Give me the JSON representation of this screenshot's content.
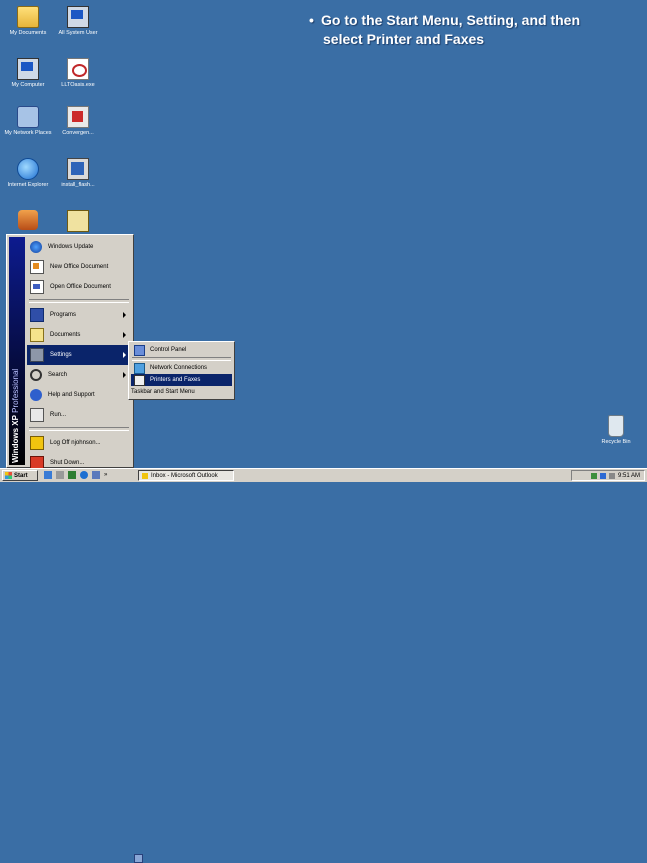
{
  "instruction": {
    "bullet": "•",
    "line1": "Go to the Start Menu, Setting, and then",
    "line2": "select Printer and Faxes"
  },
  "desktop_icons": [
    {
      "label": "My Documents",
      "icon": "folder-icon"
    },
    {
      "label": "All System User",
      "icon": "computer-icon"
    },
    {
      "label": "My Computer",
      "icon": "computer-icon"
    },
    {
      "label": "LLTOasis.exe",
      "icon": "exe-icon"
    },
    {
      "label": "My Network Places",
      "icon": "network-icon"
    },
    {
      "label": "Convergen...",
      "icon": "shortcut-icon"
    },
    {
      "label": "Internet Explorer",
      "icon": "ie-icon"
    },
    {
      "label": "install_flash...",
      "icon": "installer-icon"
    },
    {
      "label": "Recycle Bin",
      "icon": "recycle-bin-icon"
    }
  ],
  "start_menu": {
    "band_text_brand": "Windows XP",
    "band_text_edition": "Professional",
    "items": [
      {
        "label": "Windows Update",
        "icon": "windows-update-icon"
      },
      {
        "label": "New Office Document",
        "icon": "office-icon"
      },
      {
        "label": "Open Office Document",
        "icon": "open-office-icon"
      },
      {
        "label": "Programs",
        "icon": "programs-icon",
        "submenu": true
      },
      {
        "label": "Documents",
        "icon": "documents-icon",
        "submenu": true
      },
      {
        "label": "Settings",
        "icon": "settings-icon",
        "submenu": true,
        "selected": true
      },
      {
        "label": "Search",
        "icon": "search-icon",
        "submenu": true
      },
      {
        "label": "Help and Support",
        "icon": "help-icon"
      },
      {
        "label": "Run...",
        "icon": "run-icon"
      },
      {
        "label": "Log Off njohnson...",
        "icon": "logoff-icon"
      },
      {
        "label": "Shut Down...",
        "icon": "shutdown-icon"
      }
    ]
  },
  "settings_submenu": {
    "items": [
      {
        "label": "Control Panel",
        "icon": "control-panel-icon"
      },
      {
        "label": "Network Connections",
        "icon": "network-connections-icon"
      },
      {
        "label": "Printers and Faxes",
        "icon": "printer-icon",
        "highlighted": true
      },
      {
        "label": "Taskbar and Start Menu",
        "icon": "taskbar-icon"
      }
    ]
  },
  "taskbar": {
    "start_label": "Start",
    "quicklaunch_more": "»",
    "task_button": "Inbox - Microsoft Outlook",
    "clock": "9:51 AM"
  },
  "colors": {
    "desktop": "#3a6ea5",
    "menu_bg": "#d4d0c8",
    "highlight": "#0a246a",
    "band": "#0d1b8f"
  }
}
